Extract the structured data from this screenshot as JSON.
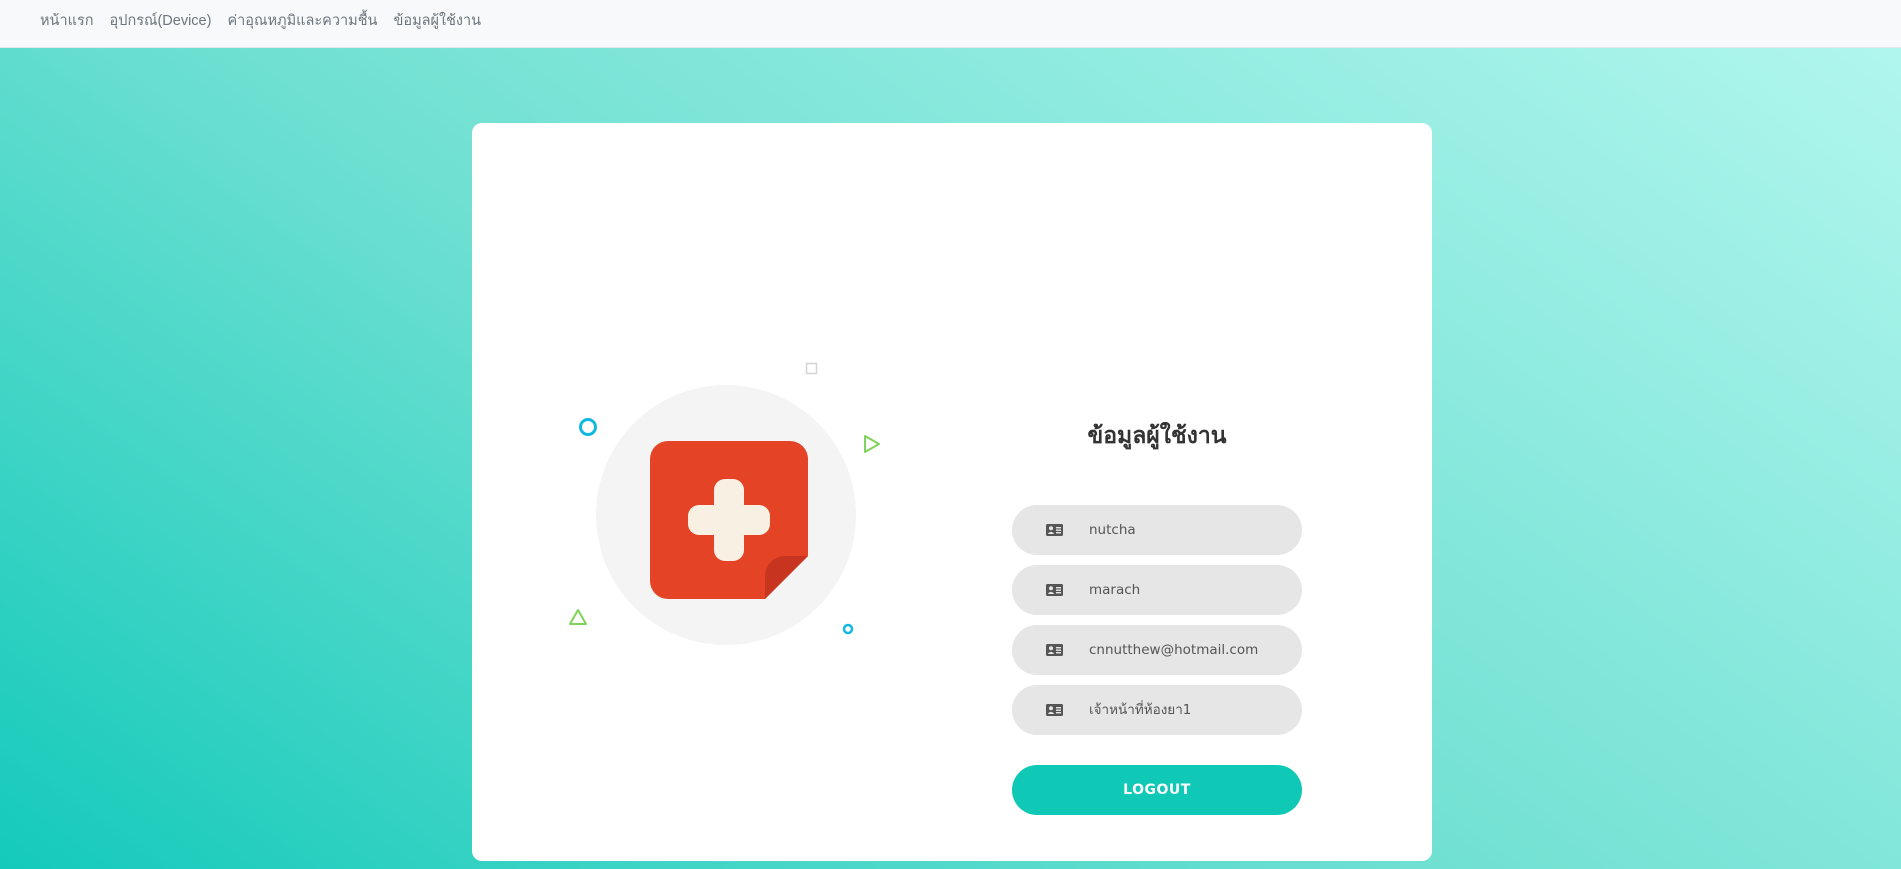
{
  "navbar": {
    "links": [
      {
        "label": "หน้าแรก"
      },
      {
        "label": "อุปกรณ์(Device)"
      },
      {
        "label": "ค่าอุณหภูมิและความชื้น"
      },
      {
        "label": "ข้อมูลผู้ใช้งาน"
      }
    ]
  },
  "profile": {
    "title": "ข้อมูลผู้ใช้งาน",
    "fields": [
      {
        "name": "first-name",
        "value": "nutcha",
        "icon": "id-card-icon"
      },
      {
        "name": "last-name",
        "value": "marach",
        "icon": "id-card-icon"
      },
      {
        "name": "email",
        "value": "cnnutthew@hotmail.com",
        "icon": "id-card-icon"
      },
      {
        "name": "role",
        "value": "เจ้าหน้าที่ห้องยา1",
        "icon": "id-card-icon"
      }
    ],
    "logout_label": "Logout"
  },
  "illustration": {
    "icon": "medical-cross-note-icon",
    "colors": {
      "note": "#e44326",
      "note_fold": "#c73420",
      "cross": "#f9f0e4",
      "circle_bg": "#f4f4f4",
      "deco_blue": "#12b8e0",
      "deco_green": "#7fd35a",
      "deco_gray": "#d4d4d4"
    }
  },
  "theme": {
    "accent": "#0fc9b6",
    "field_bg": "#e6e6e6"
  }
}
